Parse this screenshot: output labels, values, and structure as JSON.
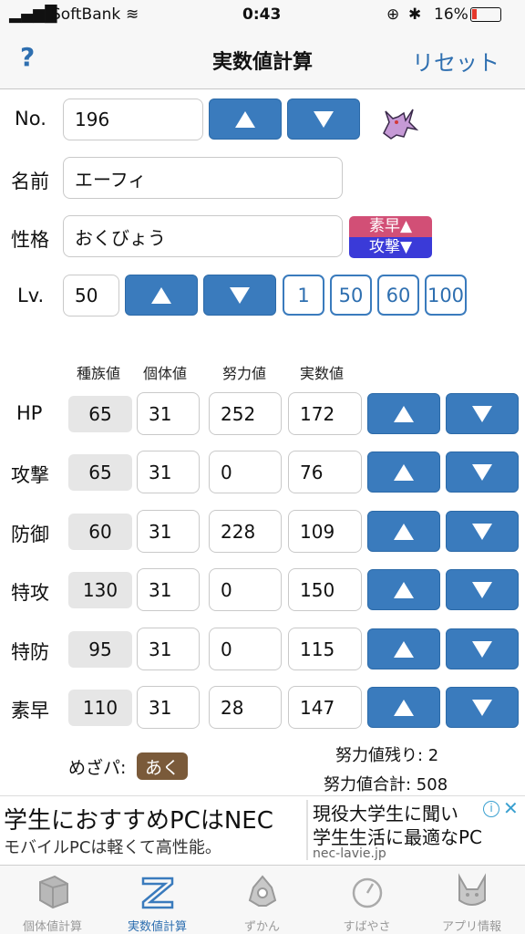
{
  "status_bar": {
    "carrier": "SoftBank",
    "time": "0:43",
    "battery": "16%"
  },
  "nav": {
    "help": "?",
    "title": "実数値計算",
    "reset": "リセット"
  },
  "form": {
    "no_label": "No.",
    "no_value": "196",
    "name_label": "名前",
    "name_value": "エーフィ",
    "nature_label": "性格",
    "nature_value": "おくびょう",
    "nature_up": "素早▲",
    "nature_down": "攻撃▼",
    "lv_label": "Lv.",
    "lv_value": "50",
    "lv_presets": [
      "1",
      "50",
      "60",
      "100"
    ]
  },
  "headers": {
    "base": "種族値",
    "iv": "個体値",
    "ev": "努力値",
    "real": "実数値"
  },
  "stats": [
    {
      "name": "HP",
      "base": "65",
      "iv": "31",
      "ev": "252",
      "real": "172"
    },
    {
      "name": "攻撃",
      "base": "65",
      "iv": "31",
      "ev": "0",
      "real": "76"
    },
    {
      "name": "防御",
      "base": "60",
      "iv": "31",
      "ev": "228",
      "real": "109"
    },
    {
      "name": "特攻",
      "base": "130",
      "iv": "31",
      "ev": "0",
      "real": "150"
    },
    {
      "name": "特防",
      "base": "95",
      "iv": "31",
      "ev": "0",
      "real": "115"
    },
    {
      "name": "素早",
      "base": "110",
      "iv": "31",
      "ev": "28",
      "real": "147"
    }
  ],
  "summary": {
    "hidden_power_label": "めざパ:",
    "hidden_power_type": "あく",
    "ev_remaining": "努力値残り: 2",
    "ev_total": "努力値合計: 508"
  },
  "ad": {
    "line1": "学生におすすめPCはNEC",
    "line2": "モバイルPCは軽くて高性能。",
    "right1": "現役大学生に聞い",
    "right2": "学生生活に最適なPC",
    "url": "nec-lavie.jp"
  },
  "tabs": [
    {
      "label": "個体値計算",
      "icon": "box-icon"
    },
    {
      "label": "実数値計算",
      "icon": "ruler-icon"
    },
    {
      "label": "ずかん",
      "icon": "pokedex-icon"
    },
    {
      "label": "すばやさ",
      "icon": "gauge-icon"
    },
    {
      "label": "アプリ情報",
      "icon": "pikachu-icon"
    }
  ],
  "colors": {
    "accent": "#3a7bbd",
    "badge_up": "#d24f76",
    "badge_down": "#3a3ad8",
    "hidden_power": "#7a5a3a"
  }
}
